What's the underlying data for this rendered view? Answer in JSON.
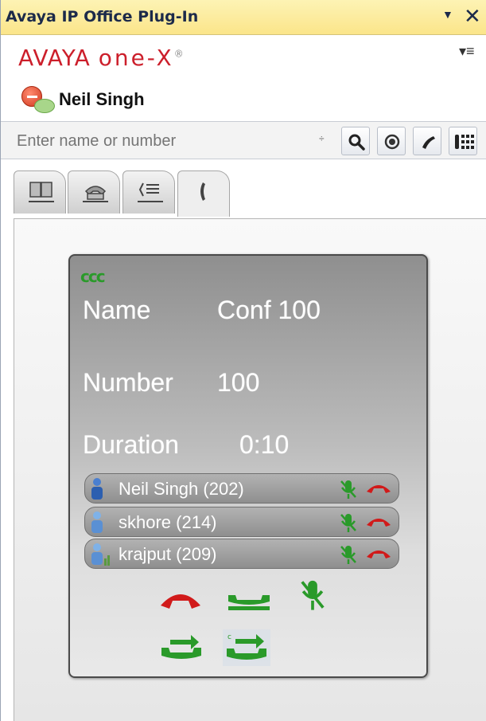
{
  "window": {
    "title": "Avaya IP Office Plug-In",
    "menu_arrow": "▼",
    "close": "✕"
  },
  "brand": {
    "avaya": "AVAYA",
    "onex": "one-X",
    "reg": "®",
    "options_menu": "▾≡"
  },
  "user": {
    "name": "Neil Singh",
    "status": "busy"
  },
  "search": {
    "placeholder": "Enter name or number",
    "spin": "÷"
  },
  "toolbar": [
    "search-icon",
    "record-icon",
    "phone-icon",
    "keypad-icon"
  ],
  "tabs": [
    {
      "name": "directory",
      "icon": "book-icon"
    },
    {
      "name": "call-history",
      "icon": "phone-list-icon"
    },
    {
      "name": "messages",
      "icon": "list-icon"
    },
    {
      "name": "active-call",
      "icon": "handset-icon",
      "active": true
    }
  ],
  "call": {
    "conf_icon": "ccc",
    "name_label": "Name",
    "name_value": "Conf 100",
    "number_label": "Number",
    "number_value": "100",
    "duration_label": "Duration",
    "duration_value": "0:10",
    "participants": [
      {
        "name": "Neil Singh (202)"
      },
      {
        "name": "skhore (214)"
      },
      {
        "name": "krajput (209)"
      }
    ],
    "actions": [
      "hangup-icon",
      "hold-icon",
      "mute-icon",
      "transfer-icon",
      "conference-transfer-icon"
    ]
  },
  "colors": {
    "accent_red": "#cc1f2b",
    "green": "#2a9a2a",
    "titlebar": "#fbe58a"
  }
}
